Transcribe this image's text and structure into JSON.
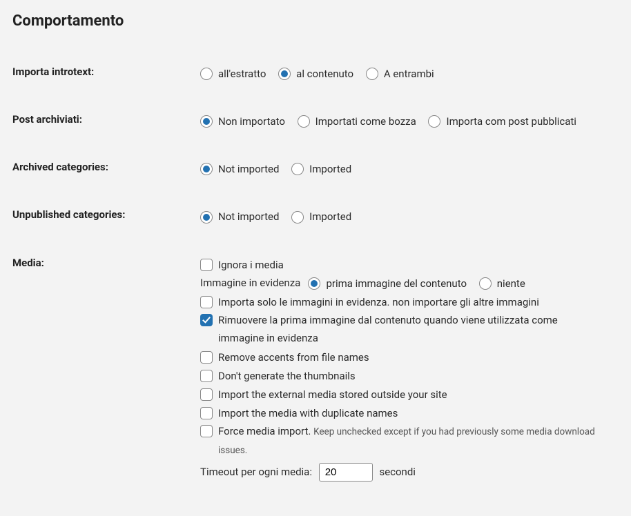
{
  "section_title": "Comportamento",
  "introtext": {
    "label": "Importa introtext:",
    "options": [
      "all'estratto",
      "al contenuto",
      "A entrambi"
    ],
    "selected_index": 1
  },
  "archived_posts": {
    "label": "Post archiviati:",
    "options": [
      "Non importato",
      "Importati come bozza",
      "Importa com post pubblicati"
    ],
    "selected_index": 0
  },
  "archived_categories": {
    "label": "Archived categories:",
    "options": [
      "Not imported",
      "Imported"
    ],
    "selected_index": 0
  },
  "unpublished_categories": {
    "label": "Unpublished categories:",
    "options": [
      "Not imported",
      "Imported"
    ],
    "selected_index": 0
  },
  "media": {
    "label": "Media:",
    "skip_media": {
      "label": "Ignora i media",
      "checked": false
    },
    "featured_image": {
      "label": "Immagine in evidenza",
      "options": [
        "prima immagine del contenuto",
        "niente"
      ],
      "selected_index": 0
    },
    "only_featured": {
      "label": "Importa solo le immagini in evidenza. non importare gli altre immagini",
      "checked": false
    },
    "remove_first": {
      "label": "Rimuovere la prima immagine dal contenuto quando viene utilizzata come immagine in evidenza",
      "checked": true
    },
    "remove_accents": {
      "label": "Remove accents from file names",
      "checked": false
    },
    "no_thumbs": {
      "label": "Don't generate the thumbnails",
      "checked": false
    },
    "external_media": {
      "label": "Import the external media stored outside your site",
      "checked": false
    },
    "dup_names": {
      "label": "Import the media with duplicate names",
      "checked": false
    },
    "force_import": {
      "label": "Force media import.",
      "note": "Keep unchecked except if you had previously some media download issues.",
      "checked": false
    },
    "timeout": {
      "label": "Timeout per ogni media:",
      "value": "20",
      "unit": "secondi"
    }
  }
}
